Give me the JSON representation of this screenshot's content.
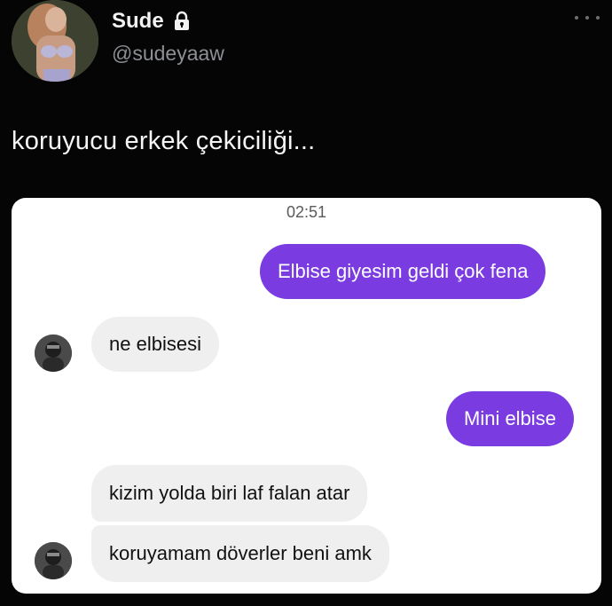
{
  "tweet": {
    "author_name": "Sude",
    "author_handle": "@sudeyaaw",
    "text": "koruyucu erkek çekiciliği...",
    "lock_icon": "lock-icon",
    "more_icon": "more-horizontal-icon"
  },
  "chat": {
    "timestamp": "02:51",
    "messages": [
      {
        "direction": "outgoing",
        "text": "Elbise giyesim geldi çok fena"
      },
      {
        "direction": "incoming",
        "text": "ne elbisesi"
      },
      {
        "direction": "outgoing",
        "text": "Mini elbise"
      },
      {
        "direction": "incoming",
        "text": "kizim yolda biri laf falan atar"
      },
      {
        "direction": "incoming",
        "text": "koruyamam döverler beni amk"
      }
    ],
    "colors": {
      "outgoing_bubble": "#7a3ce0",
      "incoming_bubble": "#efefef"
    }
  }
}
